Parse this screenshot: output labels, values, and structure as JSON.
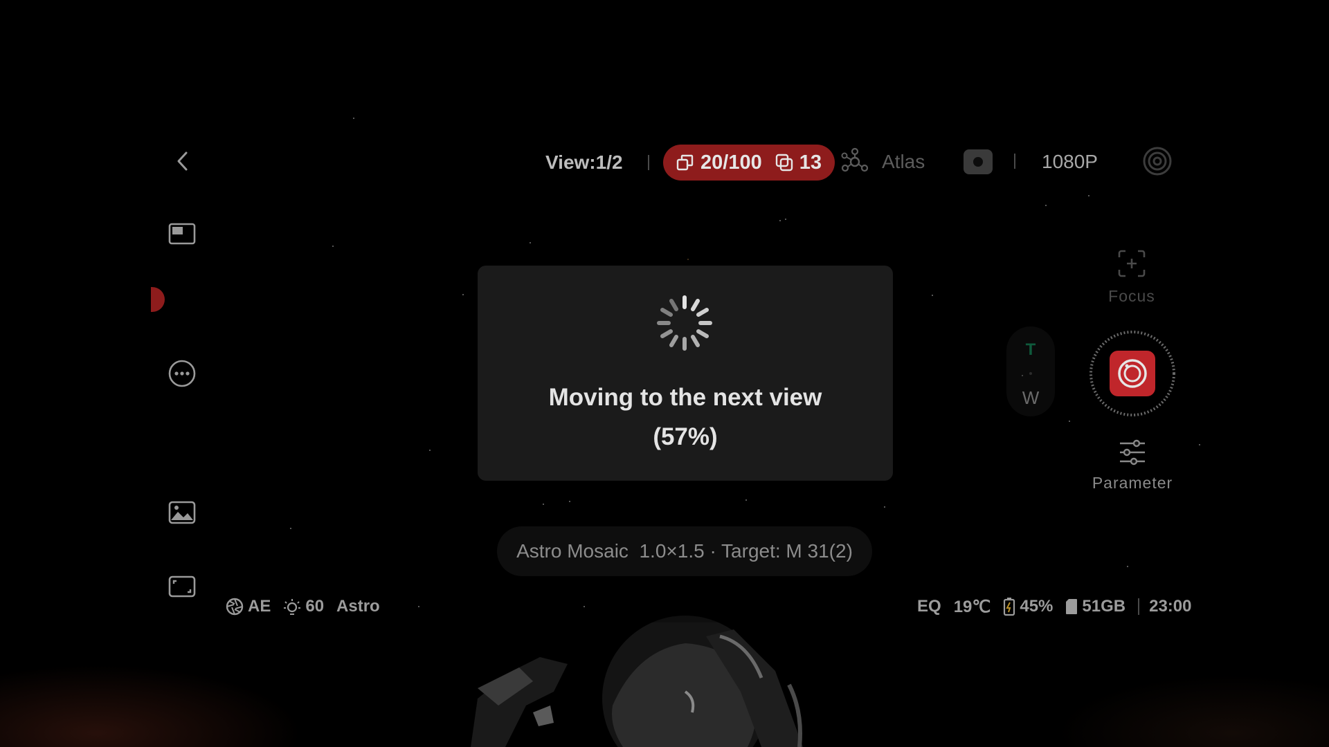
{
  "top_bar": {
    "view_label": "View:1/2",
    "frames_count": "20/100",
    "stack_count": "13",
    "atlas_label": "Atlas",
    "resolution": "1080P"
  },
  "right_panel": {
    "focus_label": "Focus",
    "zoom_tele": "T",
    "zoom_wide": "W",
    "parameter_label": "Parameter"
  },
  "modal": {
    "title": "Moving to the next view",
    "progress_text": "(57%)",
    "progress": 0.57
  },
  "mode_info": {
    "text": "Astro Mosaic  1.0×1.5 · Target: M 31(2)"
  },
  "status_left": {
    "exposure_mode": "AE",
    "brightness": "60",
    "scene_mode": "Astro"
  },
  "status_right": {
    "mount_mode": "EQ",
    "temperature": "19℃",
    "battery": "45%",
    "storage": "51GB",
    "time": "23:00"
  },
  "colors": {
    "accent_red": "#8e1c1c",
    "shutter_red": "#c0262b",
    "zoom_green": "#0f5a3c",
    "modal_bg": "#1b1b1b"
  },
  "icons": [
    "back-chevron-icon",
    "stack-frames-icon",
    "stacked-icon",
    "atlas-icon",
    "camera-icon",
    "target-ring-icon",
    "layout-icon",
    "more-icon",
    "gallery-icon",
    "fullscreen-icon",
    "focus-icon",
    "shutter-icon",
    "sliders-icon",
    "aperture-icon",
    "brightness-icon",
    "battery-icon",
    "sd-card-icon",
    "spinner-icon"
  ]
}
